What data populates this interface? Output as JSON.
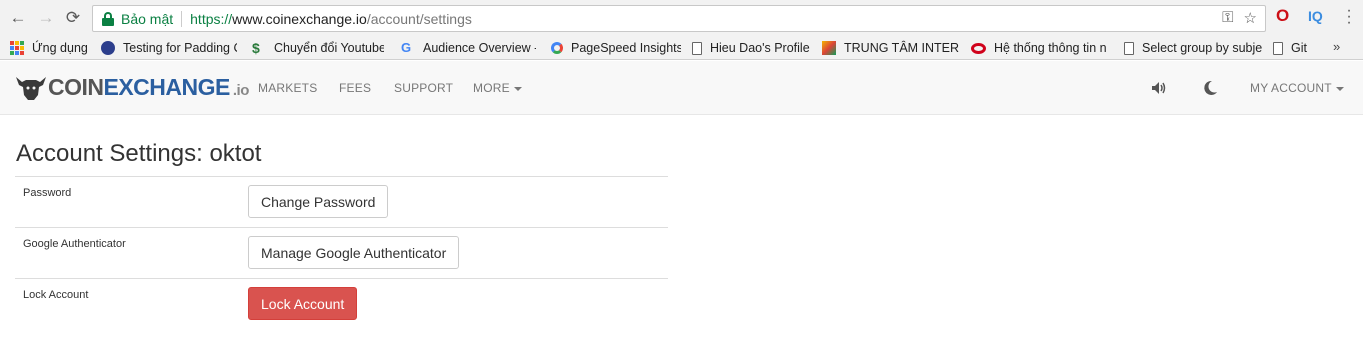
{
  "browser": {
    "secure_label": "Bảo mật",
    "url_scheme": "https://",
    "url_host": "www.coinexchange.io",
    "url_path": "/account/settings",
    "extension_iq": "IQ"
  },
  "bookmarks": [
    {
      "label": "Ứng dụng",
      "icon": "apps-grid-icon"
    },
    {
      "label": "Testing for Padding C",
      "icon": "globe-icon"
    },
    {
      "label": "Chuyển đổi Youtube",
      "icon": "dollar-icon"
    },
    {
      "label": "Audience Overview -",
      "icon": "google-icon"
    },
    {
      "label": "PageSpeed Insights",
      "icon": "pagespeed-icon"
    },
    {
      "label": "Hieu Dao's Profile",
      "icon": "page-icon"
    },
    {
      "label": "TRUNG TÂM INTERNE",
      "icon": "chart-icon"
    },
    {
      "label": "Hệ thống thông tin n",
      "icon": "oracle-icon"
    },
    {
      "label": "Select group by subje",
      "icon": "page-icon"
    },
    {
      "label": "Git",
      "icon": "page-icon"
    }
  ],
  "bookmarks_more": "»",
  "site": {
    "logo_coin": "COIN",
    "logo_exchange": "EXCHANGE",
    "logo_io": ".io",
    "nav": {
      "markets": "MARKETS",
      "fees": "FEES",
      "support": "SUPPORT",
      "more": "MORE",
      "my_account": "MY ACCOUNT"
    }
  },
  "page": {
    "title": "Account Settings: oktot",
    "rows": [
      {
        "label": "Password",
        "button": "Change Password"
      },
      {
        "label": "Google Authenticator",
        "button": "Manage Google Authenticator"
      },
      {
        "label": "Lock Account",
        "button": "Lock Account"
      }
    ]
  },
  "colors": {
    "secure_green": "#0b8043",
    "brand_blue": "#2b5fa0",
    "danger_red": "#d9534f"
  }
}
